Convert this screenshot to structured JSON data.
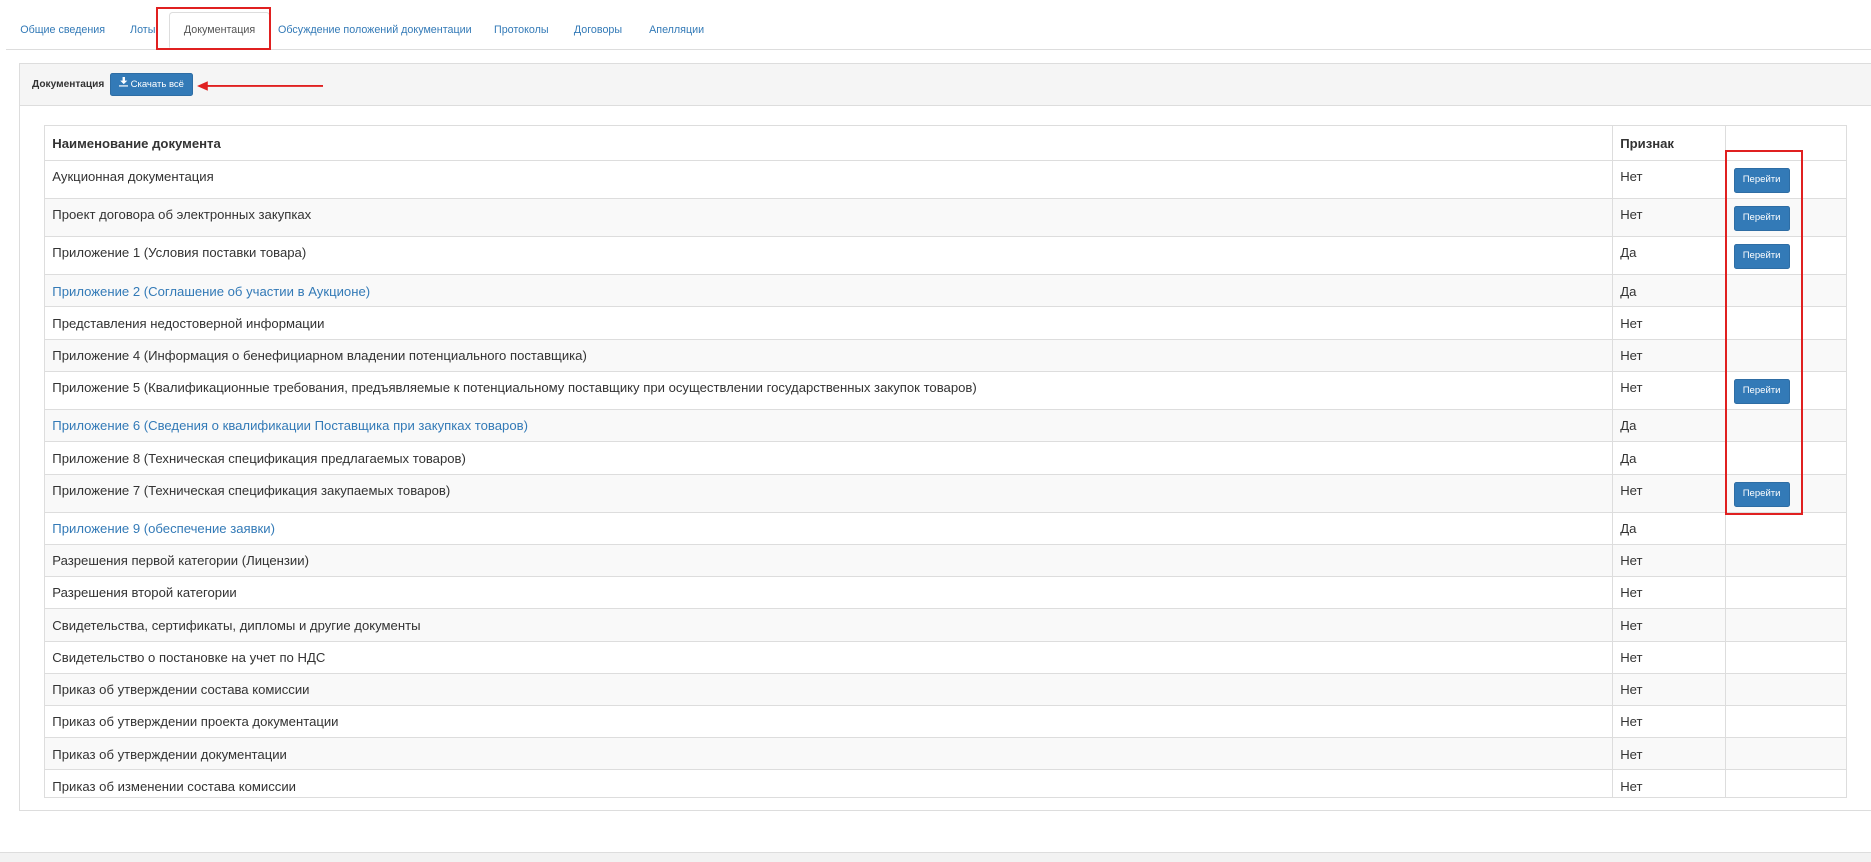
{
  "tabs": [
    "Общие сведения",
    "Лоты",
    "Документация",
    "Обсуждение положений документации",
    "Протоколы",
    "Договоры",
    "Апелляции"
  ],
  "panel": {
    "label": "Документация",
    "download_all": "Скачать всё"
  },
  "table": {
    "headers": [
      "Наименование документа",
      "Признак",
      ""
    ],
    "rows": [
      {
        "name": "Аукционная документация",
        "flag": "Нет",
        "action": "Перейти",
        "link": false
      },
      {
        "name": "Проект договора об электронных закупках",
        "flag": "Нет",
        "action": "Перейти",
        "link": false
      },
      {
        "name": "Приложение 1 (Условия поставки товара)",
        "flag": "Да",
        "action": "Перейти",
        "link": false
      },
      {
        "name": "Приложение 2 (Соглашение об участии в Аукционе)",
        "flag": "Да",
        "action": "",
        "link": true
      },
      {
        "name": "Представления недостоверной информации",
        "flag": "Нет",
        "action": "",
        "link": false
      },
      {
        "name": "Приложение 4 (Информация о бенефициарном владении потенциального поставщика)",
        "flag": "Нет",
        "action": "",
        "link": false
      },
      {
        "name": "Приложение 5 (Квалификационные требования, предъявляемые к потенциальному поставщику при осуществлении государственных закупок товаров)",
        "flag": "Нет",
        "action": "Перейти",
        "link": false
      },
      {
        "name": "Приложение 6 (Сведения о квалификации Поставщика при закупках товаров)",
        "flag": "Да",
        "action": "",
        "link": true
      },
      {
        "name": "Приложение 8 (Техническая спецификация предлагаемых товаров)",
        "flag": "Да",
        "action": "",
        "link": false
      },
      {
        "name": "Приложение 7 (Техническая спецификация закупаемых товаров)",
        "flag": "Нет",
        "action": "Перейти",
        "link": false
      },
      {
        "name": "Приложение 9 (обеспечение заявки)",
        "flag": "Да",
        "action": "",
        "link": true
      },
      {
        "name": "Разрешения первой категории (Лицензии)",
        "flag": "Нет",
        "action": "",
        "link": false
      },
      {
        "name": "Разрешения второй категории",
        "flag": "Нет",
        "action": "",
        "link": false
      },
      {
        "name": "Свидетельства, сертификаты, дипломы и другие документы",
        "flag": "Нет",
        "action": "",
        "link": false
      },
      {
        "name": "Свидетельство о постановке на учет по НДС",
        "flag": "Нет",
        "action": "",
        "link": false
      },
      {
        "name": "Приказ об утверждении состава комиссии",
        "flag": "Нет",
        "action": "",
        "link": false
      },
      {
        "name": "Приказ об утверждении проекта документации",
        "flag": "Нет",
        "action": "",
        "link": false
      },
      {
        "name": "Приказ об утверждении документации",
        "flag": "Нет",
        "action": "",
        "link": false
      },
      {
        "name": "Приказ об изменении состава комиссии",
        "flag": "Нет",
        "action": "",
        "link": false
      }
    ]
  },
  "colors": {
    "accent": "#337ab7",
    "highlight": "#e02020"
  }
}
